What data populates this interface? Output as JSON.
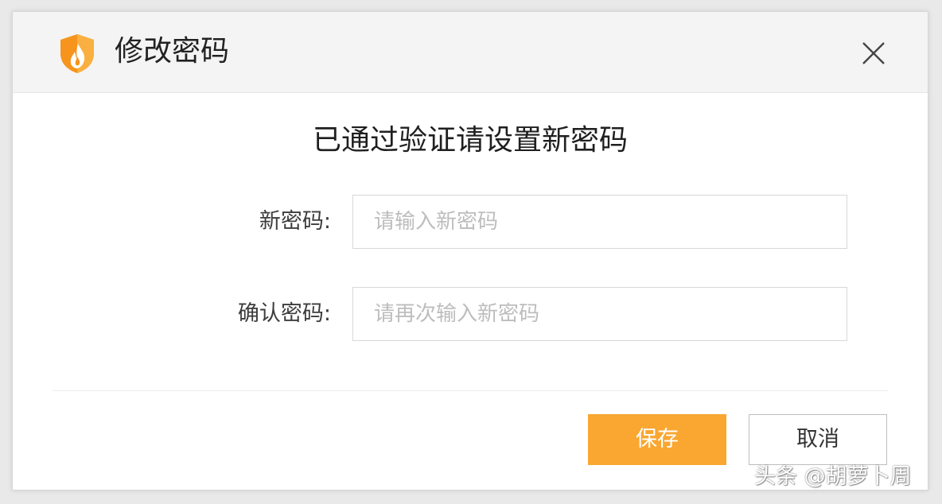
{
  "dialog": {
    "title": "修改密码",
    "logo_icon": "shield-flame-icon",
    "close_icon": "close-icon",
    "subtitle": "已通过验证请设置新密码"
  },
  "form": {
    "new_password": {
      "label": "新密码:",
      "placeholder": "请输入新密码",
      "value": ""
    },
    "confirm_password": {
      "label": "确认密码:",
      "placeholder": "请再次输入新密码",
      "value": ""
    }
  },
  "actions": {
    "save_label": "保存",
    "cancel_label": "取消"
  },
  "colors": {
    "accent": "#f9a731",
    "logo_orange": "#f7941d",
    "titlebar_bg": "#f4f4f4"
  },
  "watermark": "头条 @胡萝卜周"
}
